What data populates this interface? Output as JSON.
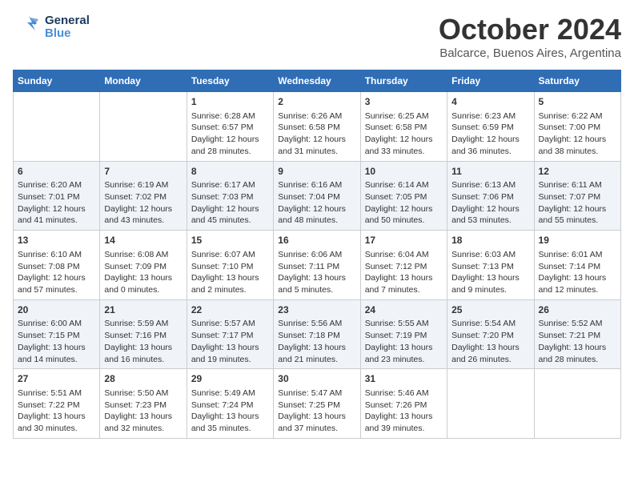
{
  "header": {
    "logo": {
      "general": "General",
      "blue": "Blue"
    },
    "title": "October 2024",
    "location": "Balcarce, Buenos Aires, Argentina"
  },
  "calendar": {
    "days": [
      "Sunday",
      "Monday",
      "Tuesday",
      "Wednesday",
      "Thursday",
      "Friday",
      "Saturday"
    ],
    "weeks": [
      [
        {
          "day": "",
          "content": ""
        },
        {
          "day": "",
          "content": ""
        },
        {
          "day": "1",
          "content": "Sunrise: 6:28 AM\nSunset: 6:57 PM\nDaylight: 12 hours\nand 28 minutes."
        },
        {
          "day": "2",
          "content": "Sunrise: 6:26 AM\nSunset: 6:58 PM\nDaylight: 12 hours\nand 31 minutes."
        },
        {
          "day": "3",
          "content": "Sunrise: 6:25 AM\nSunset: 6:58 PM\nDaylight: 12 hours\nand 33 minutes."
        },
        {
          "day": "4",
          "content": "Sunrise: 6:23 AM\nSunset: 6:59 PM\nDaylight: 12 hours\nand 36 minutes."
        },
        {
          "day": "5",
          "content": "Sunrise: 6:22 AM\nSunset: 7:00 PM\nDaylight: 12 hours\nand 38 minutes."
        }
      ],
      [
        {
          "day": "6",
          "content": "Sunrise: 6:20 AM\nSunset: 7:01 PM\nDaylight: 12 hours\nand 41 minutes."
        },
        {
          "day": "7",
          "content": "Sunrise: 6:19 AM\nSunset: 7:02 PM\nDaylight: 12 hours\nand 43 minutes."
        },
        {
          "day": "8",
          "content": "Sunrise: 6:17 AM\nSunset: 7:03 PM\nDaylight: 12 hours\nand 45 minutes."
        },
        {
          "day": "9",
          "content": "Sunrise: 6:16 AM\nSunset: 7:04 PM\nDaylight: 12 hours\nand 48 minutes."
        },
        {
          "day": "10",
          "content": "Sunrise: 6:14 AM\nSunset: 7:05 PM\nDaylight: 12 hours\nand 50 minutes."
        },
        {
          "day": "11",
          "content": "Sunrise: 6:13 AM\nSunset: 7:06 PM\nDaylight: 12 hours\nand 53 minutes."
        },
        {
          "day": "12",
          "content": "Sunrise: 6:11 AM\nSunset: 7:07 PM\nDaylight: 12 hours\nand 55 minutes."
        }
      ],
      [
        {
          "day": "13",
          "content": "Sunrise: 6:10 AM\nSunset: 7:08 PM\nDaylight: 12 hours\nand 57 minutes."
        },
        {
          "day": "14",
          "content": "Sunrise: 6:08 AM\nSunset: 7:09 PM\nDaylight: 13 hours\nand 0 minutes."
        },
        {
          "day": "15",
          "content": "Sunrise: 6:07 AM\nSunset: 7:10 PM\nDaylight: 13 hours\nand 2 minutes."
        },
        {
          "day": "16",
          "content": "Sunrise: 6:06 AM\nSunset: 7:11 PM\nDaylight: 13 hours\nand 5 minutes."
        },
        {
          "day": "17",
          "content": "Sunrise: 6:04 AM\nSunset: 7:12 PM\nDaylight: 13 hours\nand 7 minutes."
        },
        {
          "day": "18",
          "content": "Sunrise: 6:03 AM\nSunset: 7:13 PM\nDaylight: 13 hours\nand 9 minutes."
        },
        {
          "day": "19",
          "content": "Sunrise: 6:01 AM\nSunset: 7:14 PM\nDaylight: 13 hours\nand 12 minutes."
        }
      ],
      [
        {
          "day": "20",
          "content": "Sunrise: 6:00 AM\nSunset: 7:15 PM\nDaylight: 13 hours\nand 14 minutes."
        },
        {
          "day": "21",
          "content": "Sunrise: 5:59 AM\nSunset: 7:16 PM\nDaylight: 13 hours\nand 16 minutes."
        },
        {
          "day": "22",
          "content": "Sunrise: 5:57 AM\nSunset: 7:17 PM\nDaylight: 13 hours\nand 19 minutes."
        },
        {
          "day": "23",
          "content": "Sunrise: 5:56 AM\nSunset: 7:18 PM\nDaylight: 13 hours\nand 21 minutes."
        },
        {
          "day": "24",
          "content": "Sunrise: 5:55 AM\nSunset: 7:19 PM\nDaylight: 13 hours\nand 23 minutes."
        },
        {
          "day": "25",
          "content": "Sunrise: 5:54 AM\nSunset: 7:20 PM\nDaylight: 13 hours\nand 26 minutes."
        },
        {
          "day": "26",
          "content": "Sunrise: 5:52 AM\nSunset: 7:21 PM\nDaylight: 13 hours\nand 28 minutes."
        }
      ],
      [
        {
          "day": "27",
          "content": "Sunrise: 5:51 AM\nSunset: 7:22 PM\nDaylight: 13 hours\nand 30 minutes."
        },
        {
          "day": "28",
          "content": "Sunrise: 5:50 AM\nSunset: 7:23 PM\nDaylight: 13 hours\nand 32 minutes."
        },
        {
          "day": "29",
          "content": "Sunrise: 5:49 AM\nSunset: 7:24 PM\nDaylight: 13 hours\nand 35 minutes."
        },
        {
          "day": "30",
          "content": "Sunrise: 5:47 AM\nSunset: 7:25 PM\nDaylight: 13 hours\nand 37 minutes."
        },
        {
          "day": "31",
          "content": "Sunrise: 5:46 AM\nSunset: 7:26 PM\nDaylight: 13 hours\nand 39 minutes."
        },
        {
          "day": "",
          "content": ""
        },
        {
          "day": "",
          "content": ""
        }
      ]
    ]
  }
}
